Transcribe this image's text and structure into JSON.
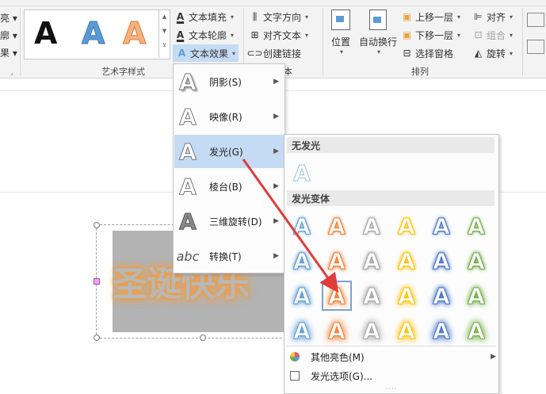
{
  "ribbon": {
    "partial_left": [
      "亮 ▾",
      "廓 ▾",
      "果 ▾"
    ],
    "wordart_styles_group": "艺术字样式",
    "text_tools": {
      "fill": "文本填充",
      "outline": "文本轮廓",
      "effects": "文本效果"
    },
    "text_group": {
      "direction": "文字方向",
      "align": "对齐文本",
      "link": "创建链接",
      "label_partial": "本"
    },
    "arrange": {
      "position": "位置",
      "wrap": "自动换行",
      "bring_forward": "上移一层",
      "send_backward": "下移一层",
      "selection_pane": "选择窗格",
      "align": "对齐",
      "group": "组合",
      "rotate": "旋转",
      "group_label": "排列"
    }
  },
  "gallery_letters": [
    "A",
    "A",
    "A"
  ],
  "colors": {
    "accent_blue": "#5b9bd5",
    "glow_orange": "#f39a3c",
    "menu_selected": "#c5daf3",
    "arrow_red": "#e23b3b"
  },
  "effects_menu": {
    "items": [
      {
        "label": "阴影(S)",
        "icon": "shadow-icon"
      },
      {
        "label": "映像(R)",
        "icon": "reflection-icon"
      },
      {
        "label": "发光(G)",
        "icon": "glow-icon",
        "selected": true
      },
      {
        "label": "棱台(B)",
        "icon": "bevel-icon"
      },
      {
        "label": "三维旋转(D)",
        "icon": "3d-rotation-icon"
      },
      {
        "label": "转换(T)",
        "icon": "transform-icon"
      }
    ]
  },
  "glow_submenu": {
    "no_glow": "无发光",
    "variants": "发光变体",
    "more_colors": "其他亮色(M)",
    "options": "发光选项(G)...",
    "grid_colors": [
      [
        "#5b9bd5",
        "#ed7d31",
        "#a5a5a5",
        "#ffc000",
        "#4472c4",
        "#70ad47"
      ],
      [
        "#5b9bd5",
        "#ed7d31",
        "#a5a5a5",
        "#ffc000",
        "#4472c4",
        "#70ad47"
      ],
      [
        "#5b9bd5",
        "#ed7d31",
        "#a5a5a5",
        "#ffc000",
        "#4472c4",
        "#70ad47"
      ],
      [
        "#5b9bd5",
        "#ed7d31",
        "#a5a5a5",
        "#ffc000",
        "#4472c4",
        "#70ad47"
      ]
    ],
    "selected_cell": [
      2,
      1
    ]
  },
  "document": {
    "wordart_text": "圣诞快乐"
  }
}
